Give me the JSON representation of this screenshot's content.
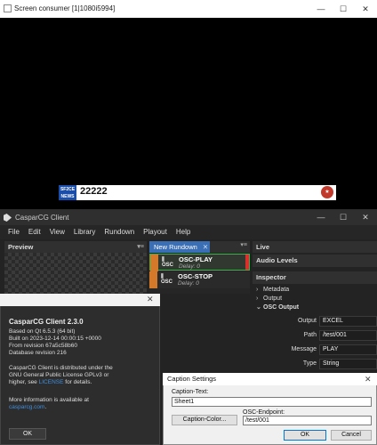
{
  "screen_consumer": {
    "title": "Screen consumer [1|1080i5994]",
    "ticker": {
      "logo_line1": "SF2CE",
      "logo_line2": "NEWS",
      "text": "22222",
      "badge": "★"
    }
  },
  "client": {
    "title": "CasparCG Client",
    "menu": [
      "File",
      "Edit",
      "View",
      "Library",
      "Rundown",
      "Playout",
      "Help"
    ],
    "preview_label": "Preview",
    "rundown_tab_label": "New Rundown",
    "rundown_items": [
      {
        "type": "OSC",
        "name": "OSC-PLAY",
        "delay": "Delay: 0"
      },
      {
        "type": "OSC",
        "name": "OSC-STOP",
        "delay": "Delay: 0"
      }
    ],
    "live_label": "Live",
    "audio_levels_label": "Audio Levels",
    "inspector_label": "Inspector",
    "inspector_tree": [
      {
        "arrow": "›",
        "label": "Metadata"
      },
      {
        "arrow": "›",
        "label": "Output"
      },
      {
        "arrow": "⌄",
        "label": "OSC Output"
      }
    ],
    "inspector_props": [
      {
        "label": "Output",
        "value": "EXCEL"
      },
      {
        "label": "Path",
        "value": "/test/001"
      },
      {
        "label": "Message",
        "value": "PLAY"
      },
      {
        "label": "Type",
        "value": "String"
      }
    ]
  },
  "about": {
    "close": "✕",
    "title": "CasparCG Client 2.3.0",
    "line1": "Based on Qt 6.5.3 (64 bit)",
    "line2": "Built on 2023-12-14 00:00:15 +0000",
    "line3": "From revision 67a5c58b60",
    "line4": "Database revision 216",
    "line5": "CasparCG Client is distributed under the",
    "line6": "GNU General Public License GPLv3 or",
    "line7_pre": "higher, see",
    "line7_link": "LICENSE",
    "line7_post": "for details.",
    "line8": "More information is available at",
    "line9_link": "casparcg.com",
    "ok": "OK"
  },
  "caption": {
    "title": "Caption Settings",
    "close": "✕",
    "text_label": "Caption-Text:",
    "text_value": "Sheet1",
    "color_button": "Caption-Color...",
    "endpoint_label": "OSC-Endpoint:",
    "endpoint_value": "/test/001",
    "ok": "OK",
    "cancel": "Cancel"
  },
  "window_controls": {
    "minimize": "—",
    "maximize": "☐",
    "close": "✕"
  }
}
